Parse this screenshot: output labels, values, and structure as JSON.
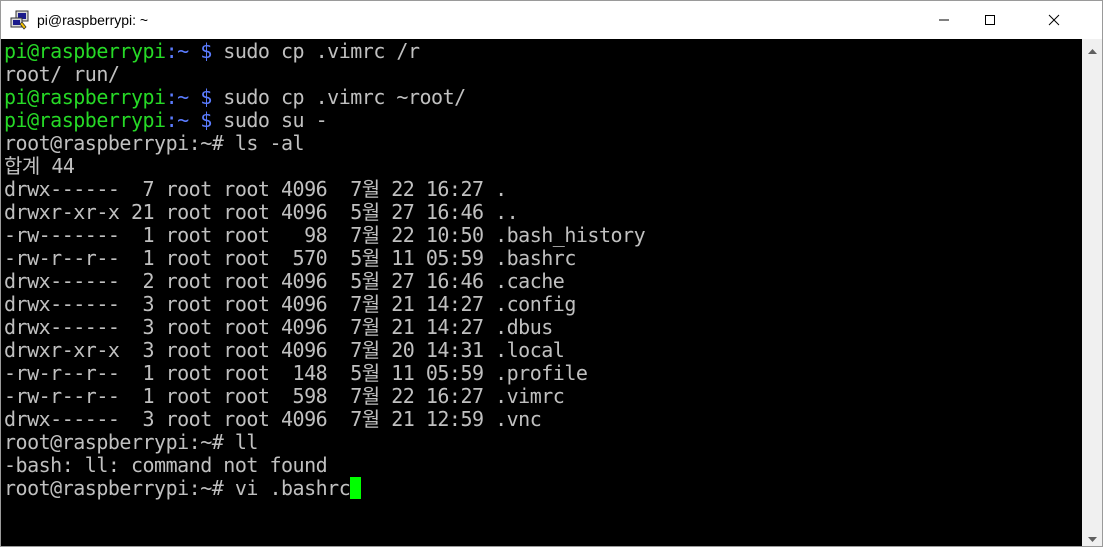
{
  "window": {
    "title": "pi@raspberrypi: ~",
    "icon": "putty-icon",
    "controls": [
      "minimize-icon",
      "maximize-icon",
      "close-icon"
    ]
  },
  "terminal": {
    "lines": [
      {
        "user": "pi@raspberrypi",
        "sep": ":",
        "path": "~",
        "sym": " $",
        "cmd": " sudo cp .vimrc /r"
      },
      {
        "text": "root/ run/"
      },
      {
        "user": "pi@raspberrypi",
        "sep": ":",
        "path": "~",
        "sym": " $",
        "cmd": " sudo cp .vimrc ~root/"
      },
      {
        "user": "pi@raspberrypi",
        "sep": ":",
        "path": "~",
        "sym": " $",
        "cmd": " sudo su -"
      },
      {
        "text": "root@raspberrypi:~# ls -al"
      },
      {
        "text": "합계 44"
      },
      {
        "text": "drwx------  7 root root 4096  7월 22 16:27 ."
      },
      {
        "text": "drwxr-xr-x 21 root root 4096  5월 27 16:46 .."
      },
      {
        "text": "-rw-------  1 root root   98  7월 22 10:50 .bash_history"
      },
      {
        "text": "-rw-r--r--  1 root root  570  5월 11 05:59 .bashrc"
      },
      {
        "text": "drwx------  2 root root 4096  5월 27 16:46 .cache"
      },
      {
        "text": "drwx------  3 root root 4096  7월 21 14:27 .config"
      },
      {
        "text": "drwx------  3 root root 4096  7월 21 14:27 .dbus"
      },
      {
        "text": "drwxr-xr-x  3 root root 4096  7월 20 14:31 .local"
      },
      {
        "text": "-rw-r--r--  1 root root  148  5월 11 05:59 .profile"
      },
      {
        "text": "-rw-r--r--  1 root root  598  7월 22 16:27 .vimrc"
      },
      {
        "text": "drwx------  3 root root 4096  7월 21 12:59 .vnc"
      },
      {
        "text": "root@raspberrypi:~# ll"
      },
      {
        "text": "-bash: ll: command not found"
      },
      {
        "text": "root@raspberrypi:~# vi .bashrc",
        "cursor": true
      }
    ]
  },
  "colors": {
    "background": "#000000",
    "text": "#c0c0c0",
    "prompt_user": "#26d926",
    "prompt_path": "#5b7cff",
    "cursor": "#00ff00"
  }
}
